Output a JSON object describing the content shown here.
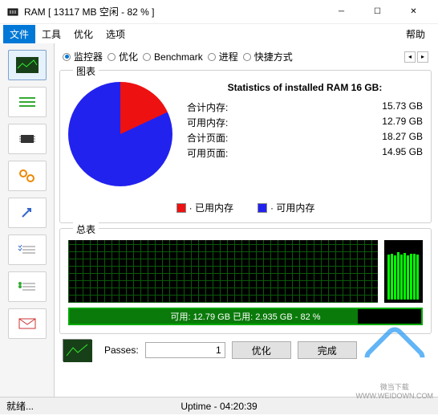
{
  "title": "RAM [ 13117 MB 空闲 - 82 % ]",
  "menu": {
    "file": "文件",
    "tools": "工具",
    "optimize": "优化",
    "options": "选项",
    "help": "帮助"
  },
  "tabs": {
    "monitor": "监控器",
    "optimize": "优化",
    "benchmark": "Benchmark",
    "process": "进程",
    "shortcut": "快捷方式"
  },
  "chart_panel_label": "图表",
  "stats_title": "Statistics of installed RAM 16 GB:",
  "stats": {
    "total_mem_label": "合计内存:",
    "total_mem_value": "15.73 GB",
    "avail_mem_label": "可用内存:",
    "avail_mem_value": "12.79 GB",
    "total_page_label": "合计页面:",
    "total_page_value": "18.27 GB",
    "avail_page_label": "可用页面:",
    "avail_page_value": "14.95 GB"
  },
  "legend": {
    "used": "· 已用内存",
    "avail": "· 可用内存"
  },
  "usage_panel_label": "总表",
  "usage_text": "可用: 12.79 GB  已用: 2.935 GB - 82 %",
  "passes_label": "Passes:",
  "passes_value": "1",
  "optimize_btn": "优化",
  "done_btn": "完成",
  "status_ready": "就绪...",
  "status_uptime": "Uptime - 04:20:39",
  "watermark": {
    "name": "微当下载",
    "url": "WWW.WEIDOWN.COM"
  },
  "chart_data": {
    "type": "pie",
    "title": "Statistics of installed RAM 16 GB",
    "series": [
      {
        "name": "已用内存",
        "value": 2.935,
        "color": "#e11"
      },
      {
        "name": "可用内存",
        "value": 12.79,
        "color": "#22e"
      }
    ],
    "unit": "GB"
  }
}
